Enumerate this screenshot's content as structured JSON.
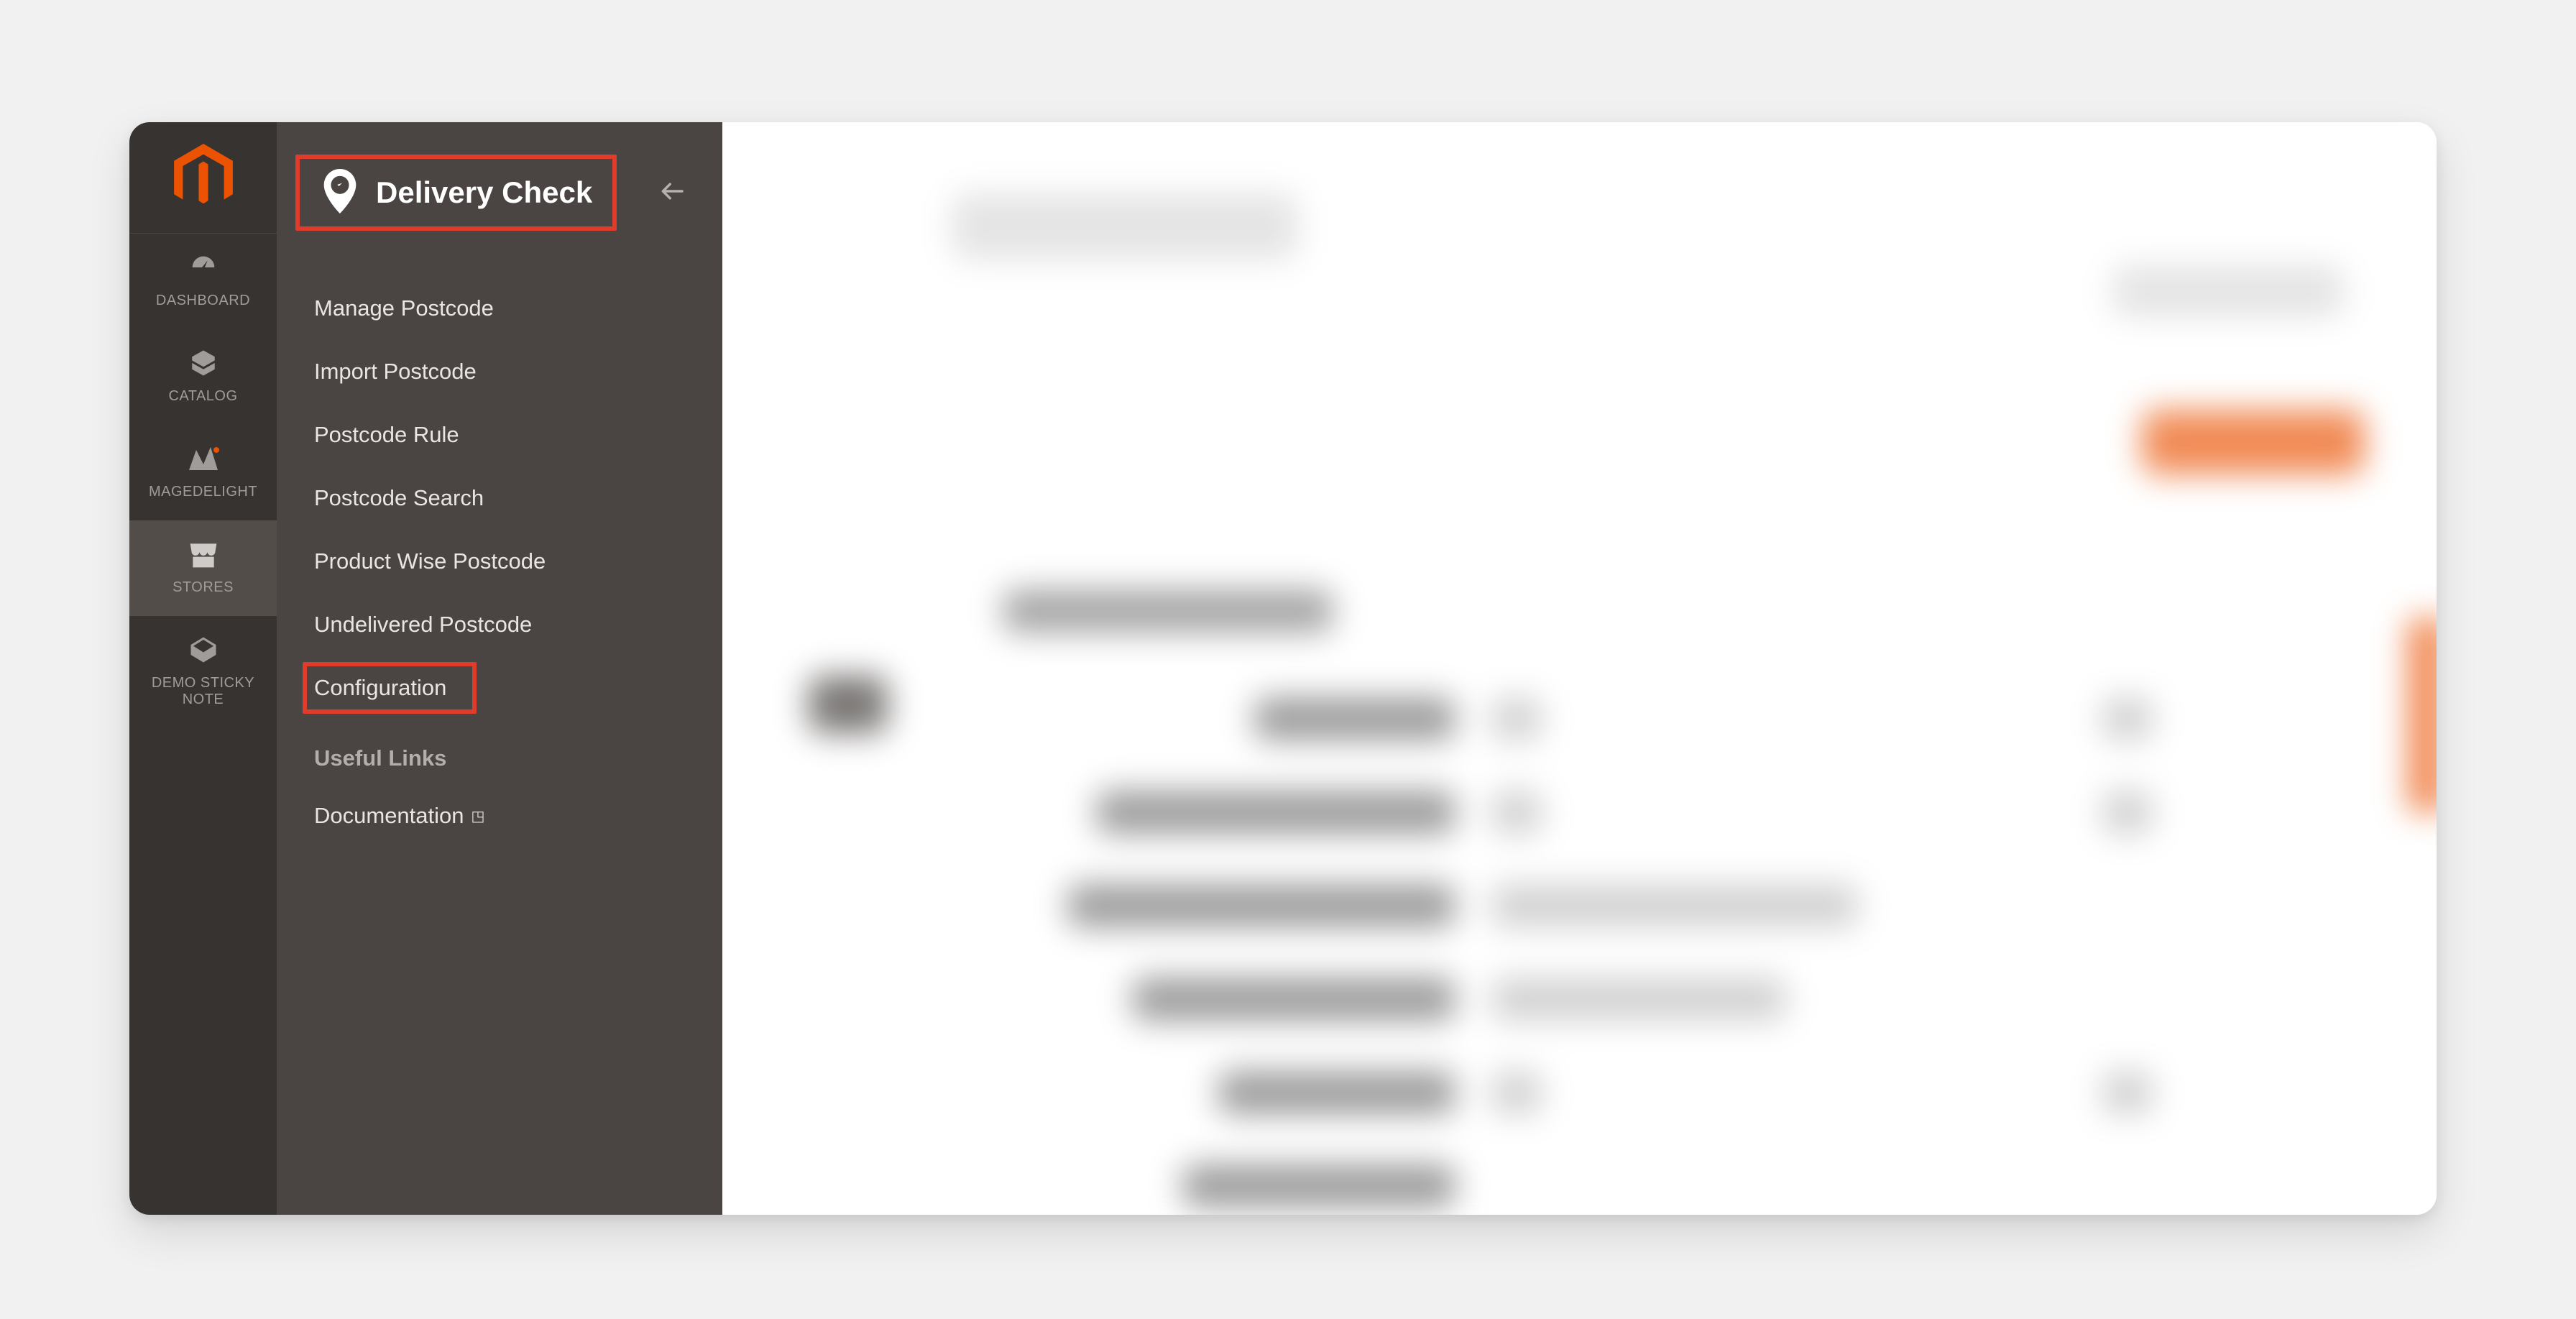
{
  "submenu": {
    "title": "Delivery Check",
    "items": [
      {
        "label": "Manage Postcode"
      },
      {
        "label": "Import Postcode"
      },
      {
        "label": "Postcode Rule"
      },
      {
        "label": "Postcode Search"
      },
      {
        "label": "Product Wise Postcode"
      },
      {
        "label": "Undelivered Postcode"
      },
      {
        "label": "Configuration"
      }
    ],
    "section_heading": "Useful Links",
    "documentation_label": "Documentation"
  },
  "navrail": {
    "items": [
      {
        "label": "DASHBOARD"
      },
      {
        "label": "CATALOG"
      },
      {
        "label": "MAGEDELIGHT"
      },
      {
        "label": "STORES"
      },
      {
        "label": "DEMO STICKY NOTE"
      }
    ]
  }
}
